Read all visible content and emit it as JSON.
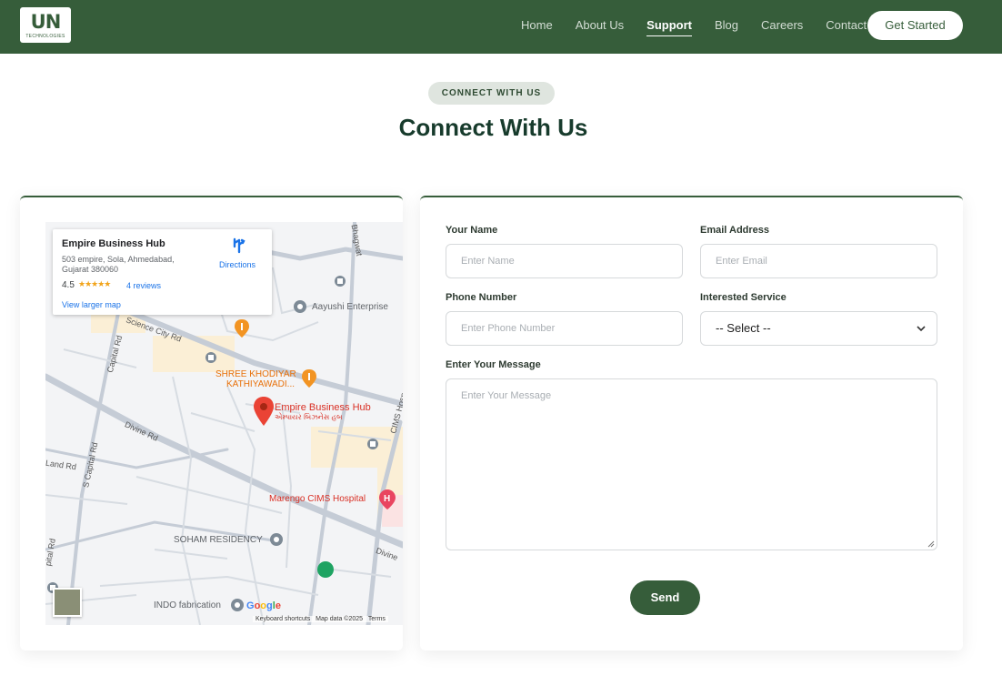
{
  "nav": {
    "logo_mark": "UN",
    "logo_sub": "TECHNOLOGIES",
    "links": [
      "Home",
      "About Us",
      "Support",
      "Blog",
      "Careers",
      "Contact"
    ],
    "active": "Support",
    "cta": "Get Started"
  },
  "header": {
    "pill": "CONNECT WITH US",
    "title": "Connect With Us"
  },
  "map": {
    "place_name": "Empire Business Hub",
    "address": "503 empire, Sola, Ahmedabad, Gujarat 380060",
    "rating": "4.5",
    "stars": "★★★★★",
    "reviews": "4 reviews",
    "view_larger": "View larger map",
    "directions": "Directions",
    "labels": {
      "aayushi": "Aayushi Enterprise",
      "shree": "SHREE KHODIYAR",
      "kathi": "KATHIYAWADI...",
      "empire": "Empire Business Hub",
      "empire_guj": "એમ્પાયર બિઝનેસ હબ",
      "marengo": "Marengo CIMS Hospital",
      "soham": "SOHAM RESIDENCY",
      "indo": "INDO fabrication",
      "science": "Science City Rd",
      "capital": "Capital Rd",
      "divine": "Divine Rd",
      "divine2": "Divine",
      "land": "Land Rd",
      "scapital": "S Capital Rd",
      "pital": "pital Rd",
      "cims": "CIMS Hosp",
      "bhagwat": "Bhagwat"
    },
    "google": "Google",
    "attrib": [
      "Keyboard shortcuts",
      "Map data ©2025",
      "Terms"
    ],
    "colors": {
      "pin": "#ea4335",
      "orange": "#e8710a",
      "link": "#1a73e8"
    }
  },
  "form": {
    "name_label": "Your Name",
    "name_placeholder": "Enter Name",
    "email_label": "Email Address",
    "email_placeholder": "Enter Email",
    "phone_label": "Phone Number",
    "phone_placeholder": "Enter Phone Number",
    "service_label": "Interested Service",
    "service_value": "-- Select --",
    "message_label": "Enter Your Message",
    "message_placeholder": "Enter Your Message",
    "send": "Send"
  },
  "colors": {
    "brand": "#365d3a",
    "title": "#173b2c"
  }
}
